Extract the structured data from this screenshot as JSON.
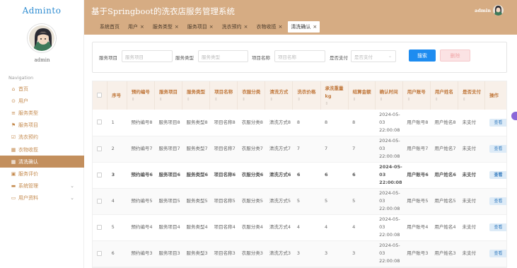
{
  "brand": "Adminto",
  "user": {
    "name": "admin"
  },
  "nav": {
    "heading": "Navigation",
    "items": [
      {
        "label": "首页",
        "icon": "home-icon",
        "glyph": "⌂",
        "active": false,
        "has_chevron": false
      },
      {
        "label": "用户",
        "icon": "user-icon",
        "glyph": "⊙",
        "active": false,
        "has_chevron": false
      },
      {
        "label": "服务类型",
        "icon": "list-icon",
        "glyph": "≡",
        "active": false,
        "has_chevron": false
      },
      {
        "label": "服务项目",
        "icon": "flag-icon",
        "glyph": "⚑",
        "active": false,
        "has_chevron": false
      },
      {
        "label": "洗衣预约",
        "icon": "checkbox-icon",
        "glyph": "☑",
        "active": false,
        "has_chevron": false
      },
      {
        "label": "衣物收揽",
        "icon": "grid-icon",
        "glyph": "▦",
        "active": false,
        "has_chevron": false
      },
      {
        "label": "清洗确认",
        "icon": "grid-icon",
        "glyph": "▦",
        "active": true,
        "has_chevron": false
      },
      {
        "label": "服务评价",
        "icon": "briefcase-icon",
        "glyph": "▣",
        "active": false,
        "has_chevron": false
      },
      {
        "label": "系统管理",
        "icon": "monitor-icon",
        "glyph": "▬",
        "active": false,
        "has_chevron": true
      },
      {
        "label": "用户资料",
        "icon": "window-icon",
        "glyph": "▭",
        "active": false,
        "has_chevron": true
      }
    ]
  },
  "header": {
    "title": "基于Springboot的洗衣店服务管理系统",
    "admin_label": "admin"
  },
  "tabs": [
    {
      "label": "系统首页",
      "closable": false,
      "active": false
    },
    {
      "label": "用户",
      "closable": true,
      "active": false
    },
    {
      "label": "服务类型",
      "closable": true,
      "active": false
    },
    {
      "label": "服务项目",
      "closable": true,
      "active": false
    },
    {
      "label": "洗衣预约",
      "closable": true,
      "active": false
    },
    {
      "label": "衣物收揽",
      "closable": true,
      "active": false
    },
    {
      "label": "清洗确认",
      "closable": true,
      "active": true
    }
  ],
  "filter": {
    "item_label": "服务项目",
    "item_placeholder": "服务项目",
    "type_label": "服务类型",
    "type_placeholder": "服务类型",
    "name_label": "项目名称",
    "name_placeholder": "项目名称",
    "pay_label": "是否支付",
    "pay_placeholder": "是否支付",
    "search_button": "搜索",
    "delete_button": "删除"
  },
  "table": {
    "columns": [
      "序号",
      "预约编号",
      "服务项目",
      "服务类型",
      "项目名称",
      "衣服分类",
      "清洗方式",
      "洗衣价格",
      "承洗重量kg",
      "结算金额",
      "确认时间",
      "用户账号",
      "用户姓名",
      "是否支付",
      "操作"
    ],
    "view_button": "查看",
    "rows": [
      [
        "1",
        "预约编号8",
        "服务项目8",
        "服务类型8",
        "项目名称8",
        "衣服分类8",
        "清洗方式8",
        "8",
        "8",
        "8",
        "2024-05-03 22:00:08",
        "用户账号8",
        "用户姓名8",
        "未支付"
      ],
      [
        "2",
        "预约编号7",
        "服务项目7",
        "服务类型7",
        "项目名称7",
        "衣服分类7",
        "清洗方式7",
        "7",
        "7",
        "7",
        "2024-05-03 22:00:08",
        "用户账号7",
        "用户姓名7",
        "未支付"
      ],
      [
        "3",
        "预约编号6",
        "服务项目6",
        "服务类型6",
        "项目名称6",
        "衣服分类6",
        "清洗方式6",
        "6",
        "6",
        "6",
        "2024-05-03 22:00:08",
        "用户账号6",
        "用户姓名6",
        "未支付"
      ],
      [
        "4",
        "预约编号5",
        "服务项目5",
        "服务类型5",
        "项目名称5",
        "衣服分类5",
        "清洗方式5",
        "5",
        "5",
        "5",
        "2024-05-03 22:00:08",
        "用户账号5",
        "用户姓名5",
        "未支付"
      ],
      [
        "5",
        "预约编号4",
        "服务项目4",
        "服务类型4",
        "项目名称4",
        "衣服分类4",
        "清洗方式4",
        "4",
        "4",
        "4",
        "2024-05-03 22:00:08",
        "用户账号4",
        "用户姓名4",
        "未支付"
      ],
      [
        "6",
        "预约编号3",
        "服务项目3",
        "服务类型3",
        "项目名称3",
        "衣服分类3",
        "清洗方式3",
        "3",
        "3",
        "3",
        "2024-05-03 22:00:08",
        "用户账号3",
        "用户姓名3",
        "未支付"
      ]
    ]
  },
  "colors": {
    "header": "#d6ac83",
    "accent": "#c38f5d",
    "primary": "#1e8cf0",
    "brand": "#2e8cd1"
  }
}
